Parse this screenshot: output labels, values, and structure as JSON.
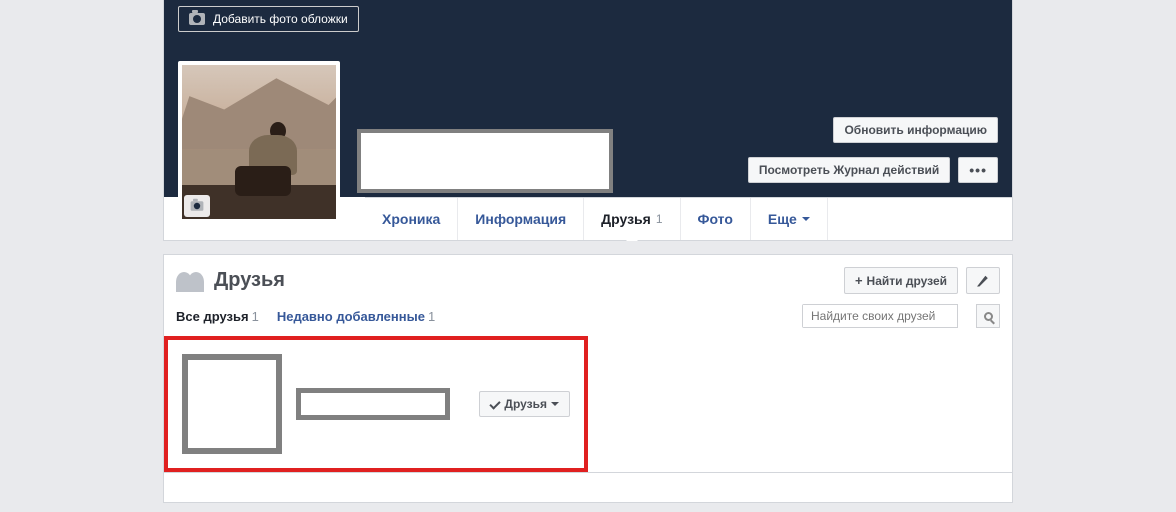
{
  "cover": {
    "add_label": "Добавить фото обложки"
  },
  "actions": {
    "update": "Обновить информацию",
    "log": "Посмотреть Журнал действий"
  },
  "tabs": {
    "timeline": "Хроника",
    "info": "Информация",
    "friends": "Друзья",
    "friends_count": "1",
    "photo": "Фото",
    "more": "Еще"
  },
  "panel": {
    "title": "Друзья",
    "find": "Найти друзей",
    "all": "Все друзья",
    "all_count": "1",
    "recent": "Недавно добавленные",
    "recent_count": "1",
    "search_placeholder": "Найдите своих друзей",
    "friend_btn": "Друзья"
  }
}
